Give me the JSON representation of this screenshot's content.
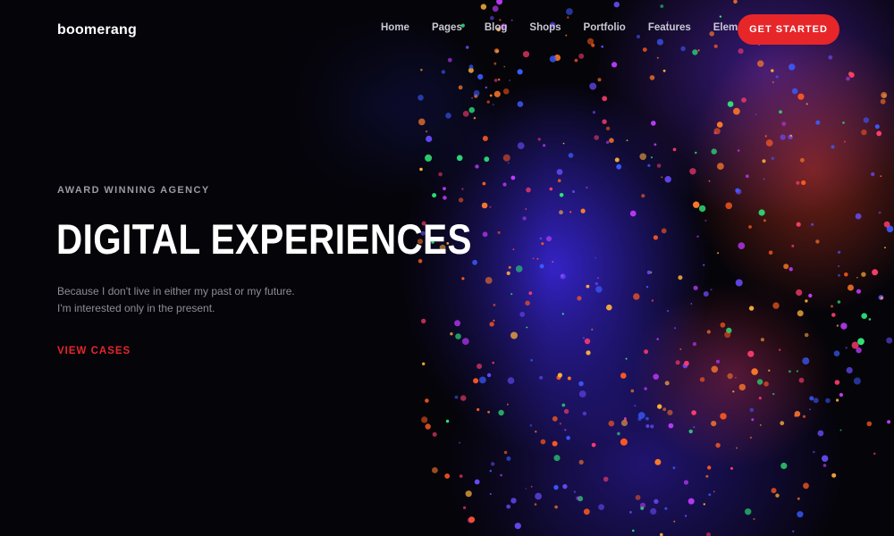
{
  "header": {
    "logo_text": "boomerang",
    "nav": [
      {
        "label": "Home"
      },
      {
        "label": "Pages"
      },
      {
        "label": "Blog"
      },
      {
        "label": "Shops"
      },
      {
        "label": "Portfolio"
      },
      {
        "label": "Features"
      },
      {
        "label": "Elements"
      }
    ],
    "cta_label": "GET STARTED"
  },
  "hero": {
    "eyebrow": "AWARD WINNING AGENCY",
    "title": "DIGITAL EXPERIENCES",
    "subtitle_line1": "Because I don't live in either my past or my future.",
    "subtitle_line2": "I'm interested only in the present.",
    "link_label": "VIEW CASES"
  },
  "colors": {
    "accent": "#e7262a",
    "background": "#050409",
    "text_primary": "#ffffff",
    "text_muted": "#8d8c98"
  }
}
